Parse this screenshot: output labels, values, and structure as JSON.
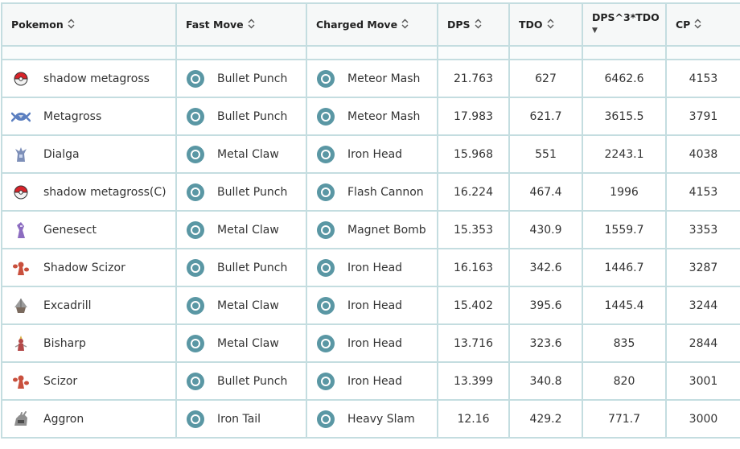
{
  "columns": [
    {
      "label": "Pokemon",
      "sort": "both"
    },
    {
      "label": "Fast Move",
      "sort": "both"
    },
    {
      "label": "Charged Move",
      "sort": "both"
    },
    {
      "label": "DPS",
      "sort": "both"
    },
    {
      "label": "TDO",
      "sort": "both"
    },
    {
      "label": "DPS^3*TDO",
      "sort": "desc"
    },
    {
      "label": "CP",
      "sort": "both"
    }
  ],
  "move_type_icon": "steel-type-icon",
  "rows": [
    {
      "pokemon": "shadow metagross",
      "icon": "pokeball-icon",
      "fast": "Bullet Punch",
      "charged": "Meteor Mash",
      "dps": "21.763",
      "tdo": "627",
      "score": "6462.6",
      "cp": "4153"
    },
    {
      "pokemon": "Metagross",
      "icon": "metagross-icon",
      "fast": "Bullet Punch",
      "charged": "Meteor Mash",
      "dps": "17.983",
      "tdo": "621.7",
      "score": "3615.5",
      "cp": "3791"
    },
    {
      "pokemon": "Dialga",
      "icon": "dialga-icon",
      "fast": "Metal Claw",
      "charged": "Iron Head",
      "dps": "15.968",
      "tdo": "551",
      "score": "2243.1",
      "cp": "4038"
    },
    {
      "pokemon": "shadow metagross(C)",
      "icon": "pokeball-icon",
      "fast": "Bullet Punch",
      "charged": "Flash Cannon",
      "dps": "16.224",
      "tdo": "467.4",
      "score": "1996",
      "cp": "4153"
    },
    {
      "pokemon": "Genesect",
      "icon": "genesect-icon",
      "fast": "Metal Claw",
      "charged": "Magnet Bomb",
      "dps": "15.353",
      "tdo": "430.9",
      "score": "1559.7",
      "cp": "3353"
    },
    {
      "pokemon": "Shadow Scizor",
      "icon": "scizor-icon",
      "fast": "Bullet Punch",
      "charged": "Iron Head",
      "dps": "16.163",
      "tdo": "342.6",
      "score": "1446.7",
      "cp": "3287"
    },
    {
      "pokemon": "Excadrill",
      "icon": "excadrill-icon",
      "fast": "Metal Claw",
      "charged": "Iron Head",
      "dps": "15.402",
      "tdo": "395.6",
      "score": "1445.4",
      "cp": "3244"
    },
    {
      "pokemon": "Bisharp",
      "icon": "bisharp-icon",
      "fast": "Metal Claw",
      "charged": "Iron Head",
      "dps": "13.716",
      "tdo": "323.6",
      "score": "835",
      "cp": "2844"
    },
    {
      "pokemon": "Scizor",
      "icon": "scizor-icon",
      "fast": "Bullet Punch",
      "charged": "Iron Head",
      "dps": "13.399",
      "tdo": "340.8",
      "score": "820",
      "cp": "3001"
    },
    {
      "pokemon": "Aggron",
      "icon": "aggron-icon",
      "fast": "Iron Tail",
      "charged": "Heavy Slam",
      "dps": "12.16",
      "tdo": "429.2",
      "score": "771.7",
      "cp": "3000"
    }
  ],
  "colors": {
    "grid_border": "#c4dde0",
    "header_bg": "#f6f8f8",
    "steel_type": "#5a97a4",
    "pokeball_red": "#d8232a",
    "metagross_blue": "#5b7fc0",
    "dialga_blue": "#7d8fb8",
    "genesect_purple": "#8c6cc0",
    "scizor_red": "#c9503d",
    "excadrill_brown": "#7a6a5e",
    "bisharp_red": "#b34848",
    "aggron_gray": "#8f8f8f"
  }
}
